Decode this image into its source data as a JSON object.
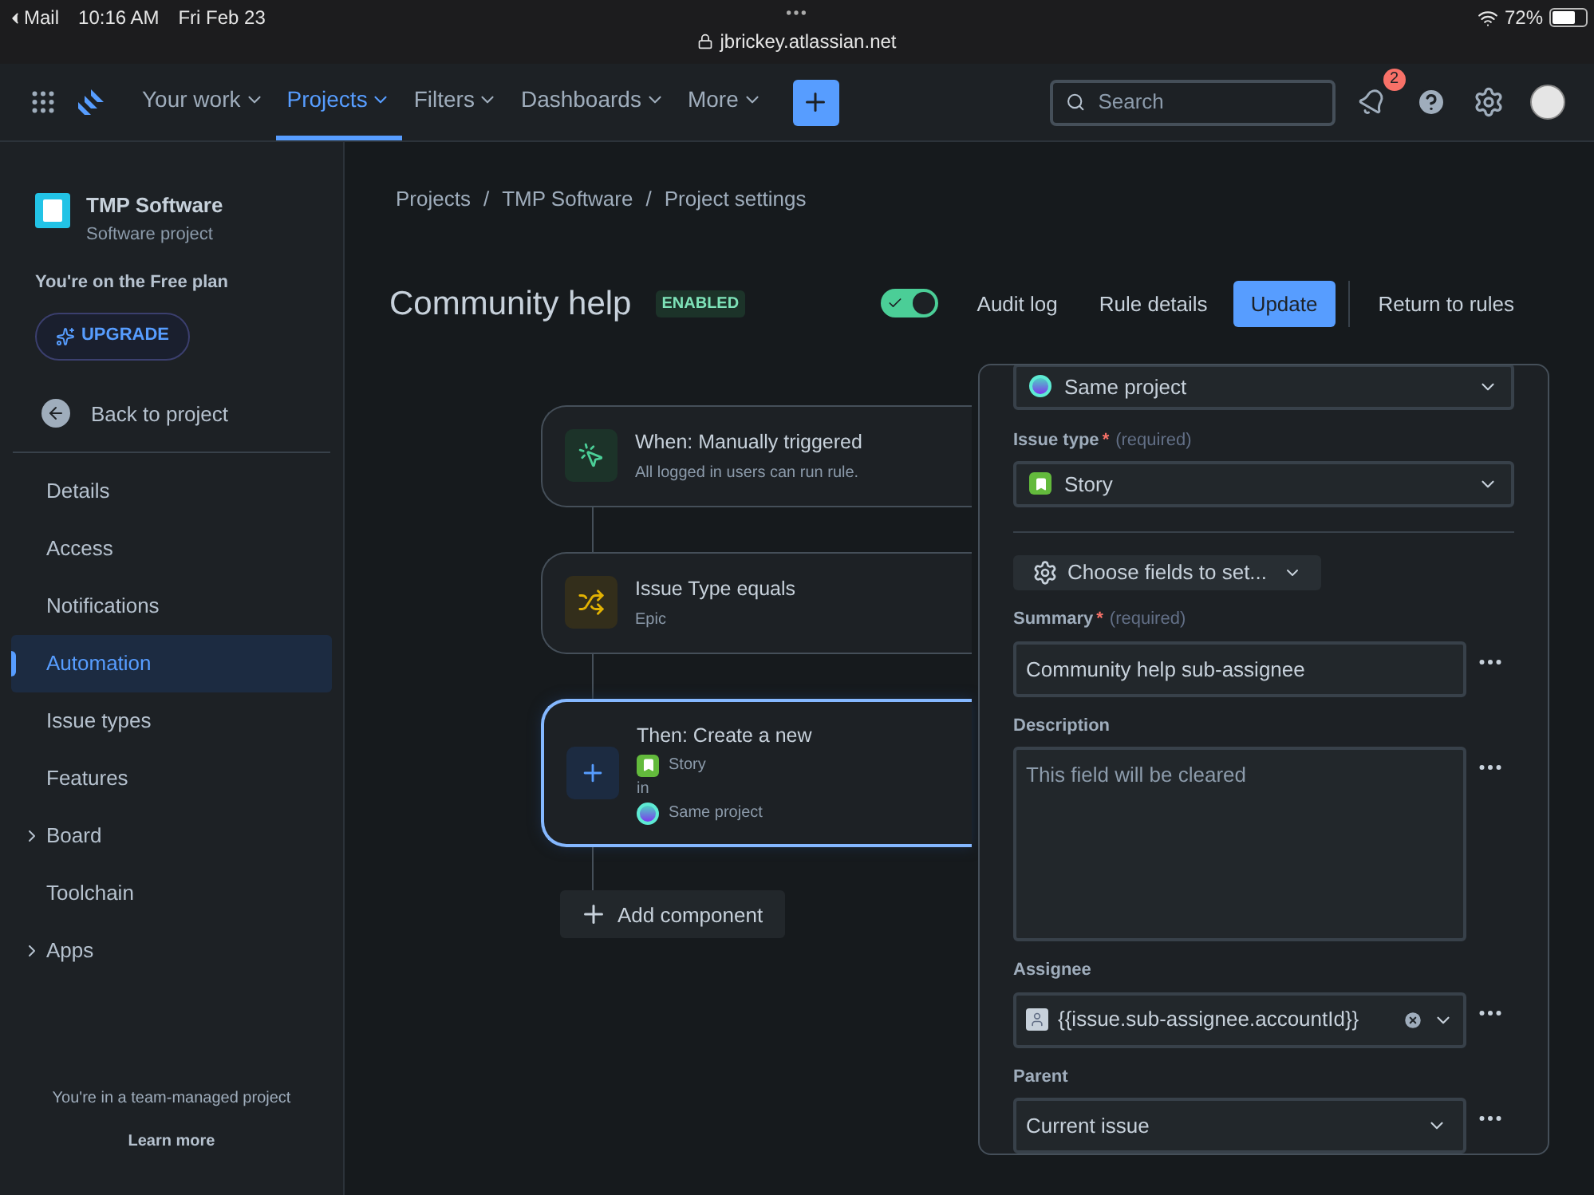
{
  "status_bar": {
    "back_app": "Mail",
    "time": "10:16 AM",
    "date": "Fri Feb 23",
    "url": "jbrickey.atlassian.net",
    "battery": "72%"
  },
  "nav": {
    "items": [
      {
        "label": "Your work",
        "selected": false
      },
      {
        "label": "Projects",
        "selected": true
      },
      {
        "label": "Filters",
        "selected": false
      },
      {
        "label": "Dashboards",
        "selected": false
      },
      {
        "label": "More",
        "selected": false
      }
    ],
    "search": {
      "placeholder": "Search"
    },
    "notification_count": "2"
  },
  "sidebar": {
    "project_name": "TMP Software",
    "project_type": "Software project",
    "plan": "You're on the Free plan",
    "upgrade": "UPGRADE",
    "back": "Back to project",
    "items": [
      {
        "label": "Details",
        "selected": false,
        "has_children": false
      },
      {
        "label": "Access",
        "selected": false,
        "has_children": false
      },
      {
        "label": "Notifications",
        "selected": false,
        "has_children": false
      },
      {
        "label": "Automation",
        "selected": true,
        "has_children": false
      },
      {
        "label": "Issue types",
        "selected": false,
        "has_children": false
      },
      {
        "label": "Features",
        "selected": false,
        "has_children": false
      },
      {
        "label": "Board",
        "selected": false,
        "has_children": true
      },
      {
        "label": "Toolchain",
        "selected": false,
        "has_children": false
      },
      {
        "label": "Apps",
        "selected": false,
        "has_children": true
      }
    ],
    "footer": "You're in a team-managed project",
    "footer_link": "Learn more"
  },
  "breadcrumbs": {
    "separator": "/",
    "items": [
      "Projects",
      "TMP Software",
      "Project settings"
    ]
  },
  "rule": {
    "title": "Community help",
    "status": "ENABLED",
    "enabled": true,
    "actions": [
      {
        "label": "Audit log",
        "kind": "link"
      },
      {
        "label": "Rule details",
        "kind": "link"
      },
      {
        "label": "Update",
        "kind": "primary"
      },
      {
        "label": "Return to rules",
        "kind": "link"
      }
    ]
  },
  "components": [
    {
      "kind": "trigger",
      "title": "When: Manually triggered",
      "subtitle": "All logged in users can run rule.",
      "selected": false
    },
    {
      "kind": "condition",
      "title": "Issue Type equals",
      "subtitle": "Epic",
      "selected": false
    },
    {
      "kind": "action",
      "title": "Then: Create a new",
      "issue_type": "Story",
      "joiner": "in",
      "project": "Same project",
      "selected": true
    }
  ],
  "add_component": "Add component",
  "panel": {
    "project": "Same project",
    "issue_type": {
      "label": "Issue type",
      "required_mark": "*",
      "hint": "(required)",
      "value": "Story"
    },
    "choose_fields": "Choose fields to set...",
    "fields": [
      {
        "kind": "input",
        "label": "Summary",
        "required_mark": "*",
        "hint": "(required)",
        "value": "Community help sub-assignee"
      },
      {
        "kind": "textarea",
        "label": "Description",
        "placeholder": "This field will be cleared"
      },
      {
        "kind": "user",
        "label": "Assignee",
        "value": "{{issue.sub-assignee.accountId}}"
      },
      {
        "kind": "select",
        "label": "Parent",
        "value": "Current issue"
      }
    ]
  }
}
